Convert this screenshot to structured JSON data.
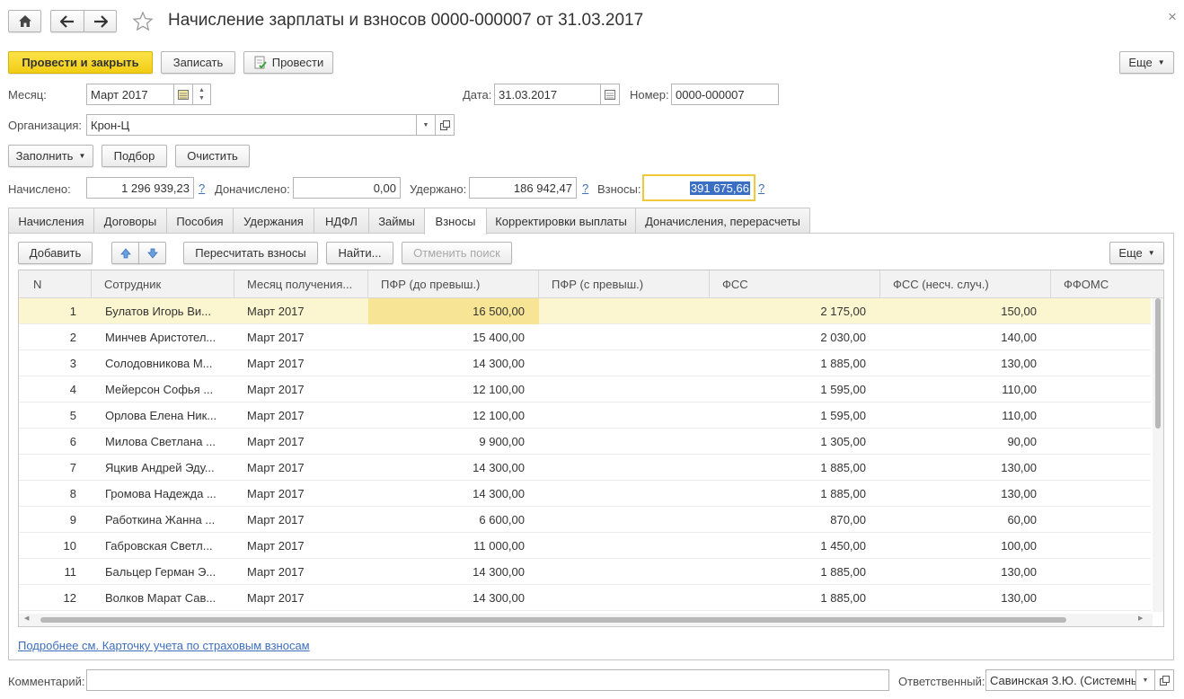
{
  "window": {
    "title": "Начисление зарплаты и взносов 0000-000007 от 31.03.2017",
    "close_glyph": "×"
  },
  "toolbar": {
    "post_close_label": "Провести и закрыть",
    "save_label": "Записать",
    "post_label": "Провести",
    "more_label": "Еще"
  },
  "header": {
    "month_label": "Месяц:",
    "month_value": "Март 2017",
    "date_label": "Дата:",
    "date_value": "31.03.2017",
    "number_label": "Номер:",
    "number_value": "0000-000007",
    "org_label": "Организация:",
    "org_value": "Крон-Ц"
  },
  "actions": {
    "fill_label": "Заполнить",
    "pick_label": "Подбор",
    "clear_label": "Очистить"
  },
  "totals": {
    "accrued_label": "Начислено:",
    "accrued_value": "1 296 939,23",
    "extra_label": "Доначислено:",
    "extra_value": "0,00",
    "withheld_label": "Удержано:",
    "withheld_value": "186 942,47",
    "contrib_label": "Взносы:",
    "contrib_value": "391 675,66",
    "help": "?"
  },
  "tabs": [
    {
      "label": "Начисления"
    },
    {
      "label": "Договоры"
    },
    {
      "label": "Пособия"
    },
    {
      "label": "Удержания"
    },
    {
      "label": "НДФЛ"
    },
    {
      "label": "Займы"
    },
    {
      "label": "Взносы"
    },
    {
      "label": "Корректировки выплаты"
    },
    {
      "label": "Доначисления, перерасчеты"
    }
  ],
  "active_tab": "Взносы",
  "table_toolbar": {
    "add_label": "Добавить",
    "recalc_label": "Пересчитать взносы",
    "find_label": "Найти...",
    "cancel_search_label": "Отменить поиск",
    "more_label": "Еще"
  },
  "columns": [
    "N",
    "Сотрудник",
    "Месяц получения...",
    "ПФР (до превыш.)",
    "ПФР (с превыш.)",
    "ФСС",
    "ФСС (несч. случ.)",
    "ФФОМС"
  ],
  "rows": [
    {
      "n": "1",
      "emp": "Булатов Игорь Ви...",
      "month": "Март 2017",
      "pfr": "16 500,00",
      "pfr2": "",
      "fss": "2 175,00",
      "fss_ns": "150,00",
      "ffoms": ""
    },
    {
      "n": "2",
      "emp": "Минчев Аристотел...",
      "month": "Март 2017",
      "pfr": "15 400,00",
      "pfr2": "",
      "fss": "2 030,00",
      "fss_ns": "140,00",
      "ffoms": ""
    },
    {
      "n": "3",
      "emp": "Солодовникова М...",
      "month": "Март 2017",
      "pfr": "14 300,00",
      "pfr2": "",
      "fss": "1 885,00",
      "fss_ns": "130,00",
      "ffoms": ""
    },
    {
      "n": "4",
      "emp": "Мейерсон Софья ...",
      "month": "Март 2017",
      "pfr": "12 100,00",
      "pfr2": "",
      "fss": "1 595,00",
      "fss_ns": "110,00",
      "ffoms": ""
    },
    {
      "n": "5",
      "emp": "Орлова Елена Ник...",
      "month": "Март 2017",
      "pfr": "12 100,00",
      "pfr2": "",
      "fss": "1 595,00",
      "fss_ns": "110,00",
      "ffoms": ""
    },
    {
      "n": "6",
      "emp": "Милова Светлана ...",
      "month": "Март 2017",
      "pfr": "9 900,00",
      "pfr2": "",
      "fss": "1 305,00",
      "fss_ns": "90,00",
      "ffoms": ""
    },
    {
      "n": "7",
      "emp": "Яцкив Андрей Эду...",
      "month": "Март 2017",
      "pfr": "14 300,00",
      "pfr2": "",
      "fss": "1 885,00",
      "fss_ns": "130,00",
      "ffoms": ""
    },
    {
      "n": "8",
      "emp": "Громова Надежда ...",
      "month": "Март 2017",
      "pfr": "14 300,00",
      "pfr2": "",
      "fss": "1 885,00",
      "fss_ns": "130,00",
      "ffoms": ""
    },
    {
      "n": "9",
      "emp": "Работкина Жанна ...",
      "month": "Март 2017",
      "pfr": "6 600,00",
      "pfr2": "",
      "fss": "870,00",
      "fss_ns": "60,00",
      "ffoms": ""
    },
    {
      "n": "10",
      "emp": "Габровская Светл...",
      "month": "Март 2017",
      "pfr": "11 000,00",
      "pfr2": "",
      "fss": "1 450,00",
      "fss_ns": "100,00",
      "ffoms": ""
    },
    {
      "n": "11",
      "emp": "Бальцер Герман Э...",
      "month": "Март 2017",
      "pfr": "14 300,00",
      "pfr2": "",
      "fss": "1 885,00",
      "fss_ns": "130,00",
      "ffoms": ""
    },
    {
      "n": "12",
      "emp": "Волков Марат Сав...",
      "month": "Март 2017",
      "pfr": "14 300,00",
      "pfr2": "",
      "fss": "1 885,00",
      "fss_ns": "130,00",
      "ffoms": ""
    }
  ],
  "link_text": "Подробнее см. Карточку учета по страховым взносам",
  "footer": {
    "comment_label": "Комментарий:",
    "comment_value": "",
    "responsible_label": "Ответственный:",
    "responsible_value": "Савинская З.Ю. (Системный"
  },
  "colors": {
    "accent_yellow": "#f5d327",
    "selected_row": "#fbf6cf",
    "selected_cell": "#f7e494",
    "link_blue": "#3d6fbd",
    "focus_border": "#f0c93a",
    "selection_bg": "#3a6fc4"
  }
}
